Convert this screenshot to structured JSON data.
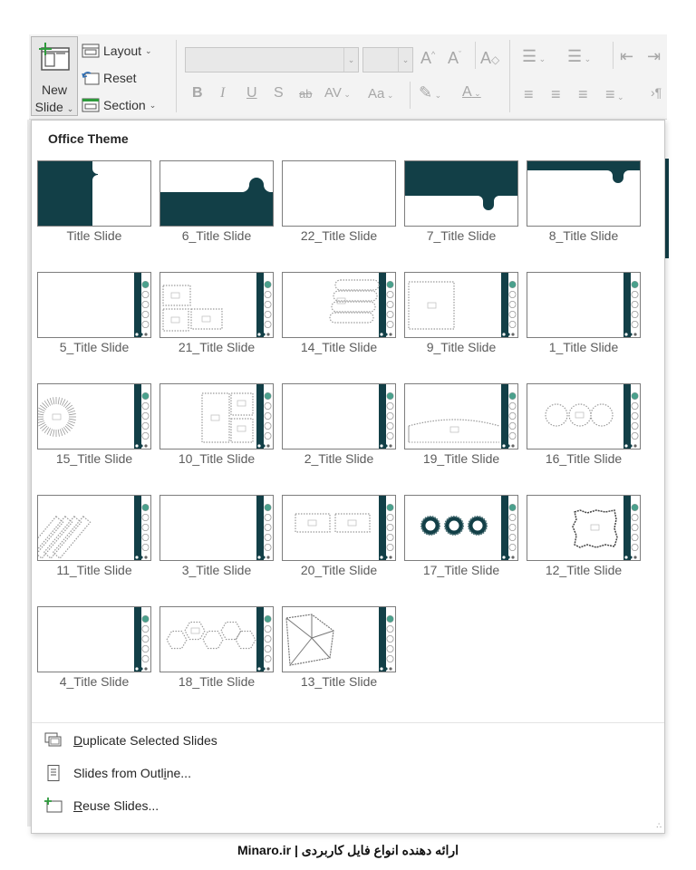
{
  "ribbon": {
    "new_slide": {
      "line1": "New",
      "line2": "Slide",
      "chevron": "chevron-down-icon"
    },
    "layout_label": "Layout",
    "reset_label": "Reset",
    "section_label": "Section"
  },
  "gallery": {
    "title": "Office Theme",
    "accent_color": "#123f47",
    "layouts": [
      {
        "label": "Title Slide",
        "variant": "title"
      },
      {
        "label": "6_Title Slide",
        "variant": "band-bottom"
      },
      {
        "label": "22_Title Slide",
        "variant": "blank"
      },
      {
        "label": "7_Title Slide",
        "variant": "band-top-tab"
      },
      {
        "label": "8_Title Slide",
        "variant": "band-top-thin"
      },
      {
        "label": "5_Title Slide",
        "variant": "sidebar"
      },
      {
        "label": "21_Title Slide",
        "variant": "sidebar-three-frames"
      },
      {
        "label": "14_Title Slide",
        "variant": "sidebar-pills"
      },
      {
        "label": "9_Title Slide",
        "variant": "sidebar-square"
      },
      {
        "label": "1_Title Slide",
        "variant": "sidebar"
      },
      {
        "label": "15_Title Slide",
        "variant": "sidebar-sunburst"
      },
      {
        "label": "10_Title Slide",
        "variant": "sidebar-grid-frames"
      },
      {
        "label": "2_Title Slide",
        "variant": "sidebar"
      },
      {
        "label": "19_Title Slide",
        "variant": "sidebar-arc"
      },
      {
        "label": "16_Title Slide",
        "variant": "sidebar-three-circles"
      },
      {
        "label": "11_Title Slide",
        "variant": "sidebar-diagonal"
      },
      {
        "label": "3_Title Slide",
        "variant": "sidebar"
      },
      {
        "label": "20_Title Slide",
        "variant": "sidebar-two-rects"
      },
      {
        "label": "17_Title Slide",
        "variant": "sidebar-three-gears"
      },
      {
        "label": "12_Title Slide",
        "variant": "sidebar-rough-frame"
      },
      {
        "label": "4_Title Slide",
        "variant": "sidebar"
      },
      {
        "label": "18_Title Slide",
        "variant": "sidebar-hexagons"
      },
      {
        "label": "13_Title Slide",
        "variant": "sidebar-polygon"
      }
    ]
  },
  "menu": {
    "duplicate": {
      "pre": "",
      "acc": "D",
      "post": "uplicate Selected Slides",
      "icon": "duplicate-slides-icon"
    },
    "outline": {
      "pre": "Slides from Outl",
      "acc": "i",
      "post": "ne...",
      "icon": "outline-document-icon"
    },
    "reuse": {
      "pre": "",
      "acc": "R",
      "post": "euse Slides...",
      "icon": "reuse-slides-icon"
    }
  },
  "footer": {
    "text": "Minaro.ir | ارائه دهنده انواع فایل کاربردی"
  }
}
